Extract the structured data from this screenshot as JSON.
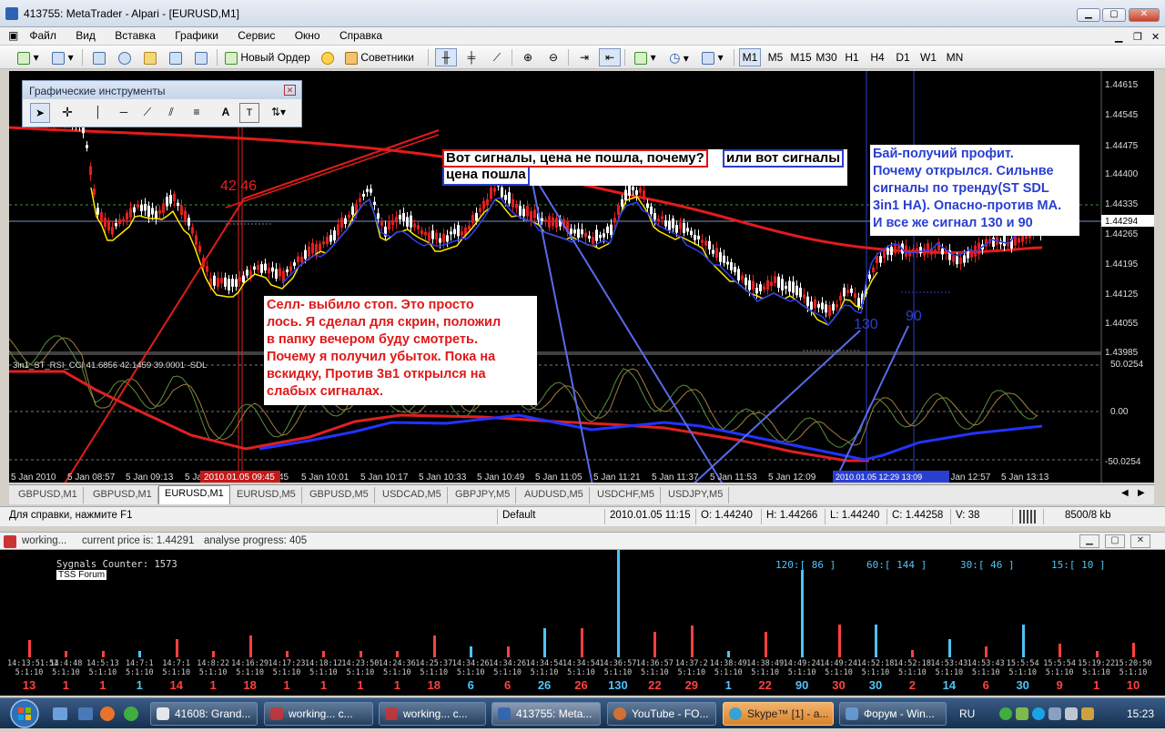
{
  "window": {
    "title": "413755: MetaTrader - Alpari - [EURUSD,M1]",
    "minimize": "▁",
    "maximize": "▢",
    "close": "✕"
  },
  "menu": [
    "Файл",
    "Вид",
    "Вставка",
    "Графики",
    "Сервис",
    "Окно",
    "Справка"
  ],
  "toolbar": {
    "new_order": "Новый Ордер",
    "advisors": "Советники",
    "timeframes": [
      "M1",
      "M5",
      "M15",
      "M30",
      "H1",
      "H4",
      "D1",
      "W1",
      "MN"
    ],
    "active_timeframe": "M1"
  },
  "tools_window": {
    "title": "Графические инструменты",
    "close": "✕"
  },
  "chart": {
    "price_levels": [
      "1.44615",
      "1.44545",
      "1.44475",
      "1.44400",
      "1.44335",
      "1.44294",
      "1.44265",
      "1.44195",
      "1.44125",
      "1.44055",
      "1.43985"
    ],
    "current_price": "1.44294",
    "time_labels": [
      "5 Jan 2010",
      "5 Jan 08:57",
      "5 Jan 09:13",
      "5 Ja",
      "45",
      "5 Jan 10:01",
      "5 Jan 10:17",
      "5 Jan 10:33",
      "5 Jan 10:49",
      "5 Jan 11:05",
      "5 Jan 11:21",
      "5 Jan 11:37",
      "5 Jan 11:53",
      "5 Jan 12:09",
      "5 Jan 12:57",
      "5 Jan 13:13"
    ],
    "crosshair_time_left": "2010.01.05 09:45",
    "crosshair_time_right": "2010.01.05 12:29 13:09",
    "indicator_label": "3in1_ST_RSI_CCI 41.6856 42.1459 39.0001 -SDL",
    "indicator_levels": [
      "50.0254",
      "0.00",
      "-50.0254"
    ],
    "marker_4246": "42 46",
    "marker_130": "130",
    "marker_90": "90"
  },
  "annotations": {
    "question_line1": "Вот сигналы, цена не пошла, почему?",
    "question_part2": "или вот сигналы",
    "question_line2": "цена пошла",
    "sell_note": [
      "Селл- выбило стоп. Это просто",
      "лось. Я сделал для скрин, положил",
      "в папку вечером буду смотреть.",
      "Почему я получил убыток. Пока на",
      "вскидку, Против 3в1 открылся на",
      "слабых сигналах."
    ],
    "buy_note": [
      "Бай-получий профит.",
      "Почему открылся. Сильнве",
      "сигналы по тренду(ST SDL",
      "3in1 HA). Опасно-против МА.",
      "И все же сигнал 130 и 90"
    ]
  },
  "tabs": [
    "GBPUSD,M1",
    "GBPUSD,M1",
    "EURUSD,M1",
    "EURUSD,M5",
    "GBPUSD,M5",
    "USDCAD,M5",
    "GBPJPY,M5",
    "AUDUSD,M5",
    "USDCHF,M5",
    "USDJPY,M5"
  ],
  "active_tab": "EURUSD,M1",
  "status": {
    "help": "Для справки, нажмите F1",
    "profile": "Default",
    "datetime": "2010.01.05 11:15",
    "open": "O: 1.44240",
    "high": "H: 1.44266",
    "low": "L: 1.44240",
    "close": "C: 1.44258",
    "volume": "V: 38",
    "traffic": "8500/8 kb"
  },
  "panel": {
    "state": "working...",
    "price_text": "current price is: 1.44291",
    "progress_text": "analyse progress: 405",
    "counter": "Sygnals Counter: 1573",
    "forum": "TSS Forum",
    "groups": [
      "120:[ 86 ]",
      "60:[ 144 ]",
      "30:[ 46 ]",
      "15:[ 10 ]"
    ]
  },
  "histogram": {
    "times": [
      "14:13:51:53",
      "14:4:48",
      "14:5:13",
      "14:7:1",
      "14:7:1",
      "14:8:22",
      "14:16:29",
      "14:17:23",
      "14:18:12",
      "14:23:50",
      "14:24:36",
      "14:25:37",
      "14:34:26",
      "14:34:26",
      "14:34:54",
      "14:34:54",
      "14:36:57",
      "14:36:57",
      "14:37:2",
      "14:38:49",
      "14:38:49",
      "14:49:24",
      "14:49:24",
      "14:52:18",
      "14:52:18",
      "14:53:43",
      "14:53:43",
      "15:5:54",
      "15:5:54",
      "15:19:22",
      "15:20:50"
    ],
    "params": [
      "5:1:10",
      "5:1:10",
      "5:1:10",
      "5:1:10",
      "5:1:10",
      "5:1:10",
      "5:1:10",
      "5:1:10",
      "5:1:10",
      "5:1:10",
      "5:1:10",
      "5:1:10",
      "5:1:10",
      "5:1:10",
      "5:1:10",
      "5:1:10",
      "5:1:10",
      "5:1:10",
      "5:1:10",
      "5:1:10",
      "5:1:10",
      "5:1:10",
      "5:1:10",
      "5:1:10",
      "5:1:10",
      "5:1:10",
      "5:1:10",
      "5:1:10",
      "5:1:10",
      "5:1:10",
      "5:1:10"
    ],
    "values": [
      "13",
      "1",
      "1",
      "1",
      "14",
      "1",
      "18",
      "1",
      "1",
      "1",
      "1",
      "18",
      "6",
      "6",
      "26",
      "26",
      "130",
      "22",
      "29",
      "1",
      "22",
      "90",
      "30",
      "30",
      "2",
      "14",
      "6",
      "30",
      "9",
      "1",
      "10"
    ],
    "value_colors": [
      "#ff4040",
      "#ff4040",
      "#ff4040",
      "#4fc3f7",
      "#ff4040",
      "#ff4040",
      "#ff4040",
      "#ff4040",
      "#ff4040",
      "#ff4040",
      "#ff4040",
      "#ff4040",
      "#4fc3f7",
      "#ff4040",
      "#4fc3f7",
      "#ff4040",
      "#4fc3f7",
      "#ff4040",
      "#ff4040",
      "#4fc3f7",
      "#ff4040",
      "#4fc3f7",
      "#ff4040",
      "#4fc3f7",
      "#ff4040",
      "#4fc3f7",
      "#ff4040",
      "#4fc3f7",
      "#ff4040",
      "#ff4040",
      "#ff4040"
    ]
  },
  "taskbar": {
    "tasks": [
      "41608: Grand...",
      "working...  c...",
      "working...  c...",
      "413755: Meta...",
      "YouTube - FO...",
      "Skype™ [1] - a...",
      "Форум - Win..."
    ],
    "lang": "RU",
    "clock": "15:23"
  }
}
